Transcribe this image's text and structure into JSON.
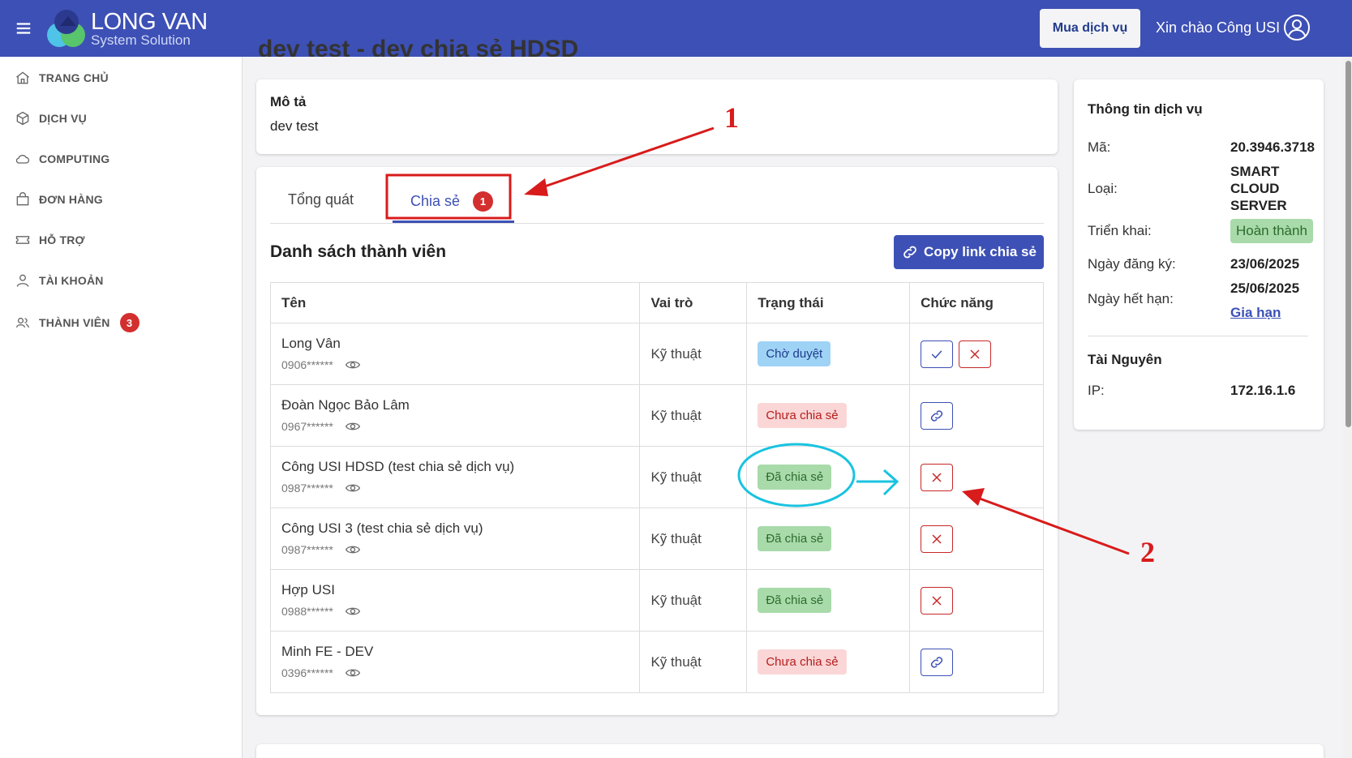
{
  "header": {
    "logo_title": "LONG VAN",
    "logo_subtitle": "System Solution",
    "buy_button": "Mua dịch vụ",
    "greeting": "Xin chào Công USI"
  },
  "sidebar": {
    "items": [
      {
        "label": "TRANG CHỦ",
        "icon": "home-icon"
      },
      {
        "label": "DỊCH VỤ",
        "icon": "cube-icon"
      },
      {
        "label": "COMPUTING",
        "icon": "cloud-icon"
      },
      {
        "label": "ĐƠN HÀNG",
        "icon": "bag-icon"
      },
      {
        "label": "HỖ TRỢ",
        "icon": "ticket-icon"
      },
      {
        "label": "TÀI KHOẢN",
        "icon": "user-icon"
      },
      {
        "label": "THÀNH VIÊN",
        "icon": "users-icon",
        "badge": "3"
      }
    ]
  },
  "page": {
    "title_cut": "dev test - dev chia sẻ HDSD"
  },
  "description": {
    "label": "Mô tả",
    "value": "dev test"
  },
  "tabs": {
    "general": "Tổng quát",
    "share": "Chia sẻ",
    "share_badge": "1"
  },
  "members": {
    "title": "Danh sách thành viên",
    "copy_link_button": "Copy link chia sẻ",
    "headers": [
      "Tên",
      "Vai trò",
      "Trạng thái",
      "Chức năng"
    ],
    "rows": [
      {
        "name": "Long Vân",
        "phone": "0906******",
        "role": "Kỹ thuật",
        "status": "Chờ duyệt"
      },
      {
        "name": "Đoàn Ngọc Bảo Lâm",
        "phone": "0967******",
        "role": "Kỹ thuật",
        "status": "Chưa chia sẻ"
      },
      {
        "name": "Công USI HDSD (test chia sẻ dịch vụ)",
        "phone": "0987******",
        "role": "Kỹ thuật",
        "status": "Đã chia sẻ"
      },
      {
        "name": "Công USI 3 (test chia sẻ dịch vụ)",
        "phone": "0987******",
        "role": "Kỹ thuật",
        "status": "Đã chia sẻ"
      },
      {
        "name": "Hợp USI",
        "phone": "0988******",
        "role": "Kỹ thuật",
        "status": "Đã chia sẻ"
      },
      {
        "name": "Minh FE - DEV",
        "phone": "0396******",
        "role": "Kỹ thuật",
        "status": "Chưa chia sẻ"
      }
    ]
  },
  "service_info": {
    "title": "Thông tin dịch vụ",
    "code_label": "Mã:",
    "code_value": "20.3946.3718",
    "type_label": "Loại:",
    "type_value_1": "SMART",
    "type_value_2": "CLOUD",
    "type_value_3": "SERVER",
    "deploy_label": "Triển khai:",
    "deploy_value": "Hoàn thành",
    "register_label": "Ngày đăng ký:",
    "register_value": "23/06/2025",
    "expire_label": "Ngày hết hạn:",
    "expire_value": "25/06/2025",
    "renew_link": "Gia hạn",
    "resource_title": "Tài Nguyên",
    "ip_label": "IP:",
    "ip_value": "172.16.1.6"
  },
  "annotations": {
    "one": "1",
    "two": "2"
  },
  "colors": {
    "primary": "#3d50b5",
    "danger": "#d32f2f",
    "annotation_red": "#d81b1b",
    "annotation_cyan": "#19c3e0"
  }
}
